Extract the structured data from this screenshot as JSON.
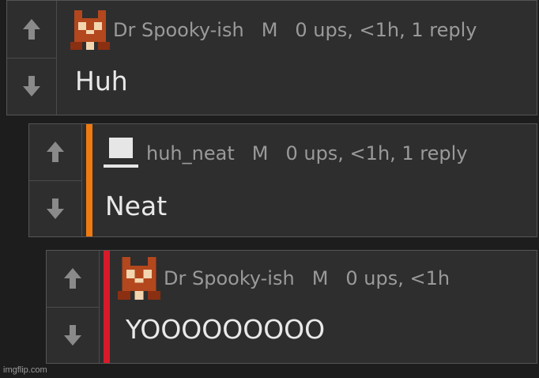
{
  "colors": {
    "depth1_stripe": "#f07a10",
    "depth2_stripe": "#d81a2a"
  },
  "comments": [
    {
      "author": "Dr Spooky-ish",
      "badge": "M",
      "score": "0 ups, <1h, 1 reply",
      "body": "Huh",
      "avatar_icon": "pixel-cat-avatar-icon"
    },
    {
      "author": "huh_neat",
      "badge": "M",
      "score": "0 ups, <1h, 1 reply",
      "body": "Neat",
      "avatar_icon": "default-blank-avatar-icon"
    },
    {
      "author": "Dr Spooky-ish",
      "badge": "M",
      "score": "0 ups, <1h",
      "body": "YOOOOOOOOO",
      "avatar_icon": "pixel-cat-avatar-icon"
    }
  ],
  "watermark": "imgflip.com"
}
